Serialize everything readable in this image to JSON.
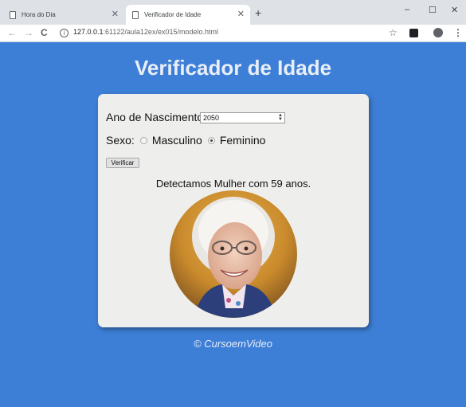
{
  "browser": {
    "tabs": [
      {
        "label": "Hora do Dia",
        "active": false
      },
      {
        "label": "Verificador de Idade",
        "active": true
      }
    ],
    "new_tab_glyph": "+",
    "window_controls": {
      "minimize": "–",
      "maximize": "☐",
      "close": "✕"
    },
    "nav": {
      "back": "←",
      "forward": "→",
      "reload": "C"
    },
    "url_host": "127.0.0.1",
    "url_path": ":61122/aula12ex/ex015/modelo.html",
    "icons": [
      "info-icon",
      "star-icon",
      "extension-icon",
      "profile-icon",
      "menu-icon"
    ]
  },
  "page": {
    "title": "Verificador de Idade",
    "birth_label": "Ano de Nascimento:",
    "birth_value": "2050",
    "sex_label": "Sexo:",
    "options": [
      "Masculino",
      "Feminino"
    ],
    "selected_option": "Feminino",
    "button_label": "Verificar",
    "result_text": "Detectamos Mulher com 59 anos.",
    "footer": "© CursoemVideo"
  },
  "colors": {
    "page_bg": "#3d7fd6",
    "card_bg": "#eeeeec",
    "title_color": "#e9eef8"
  }
}
